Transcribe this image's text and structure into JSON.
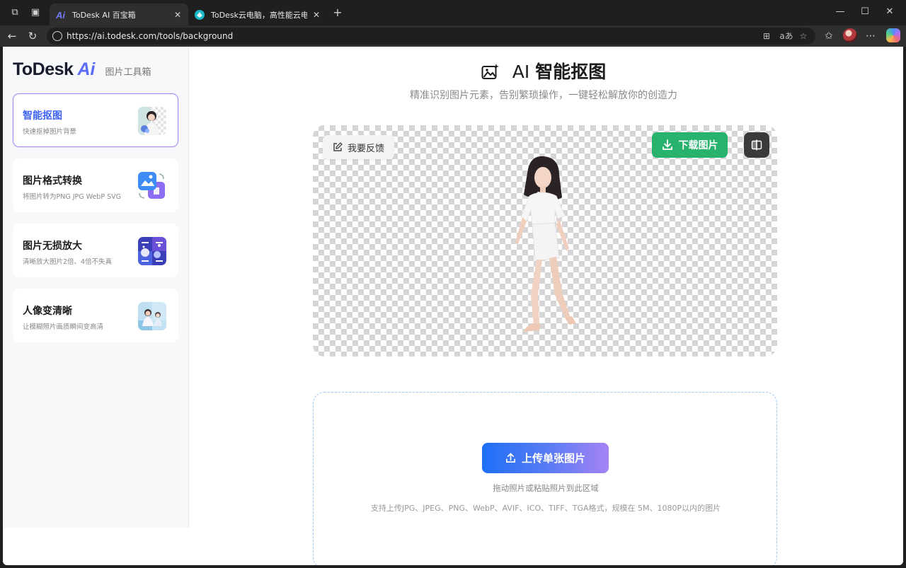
{
  "browser": {
    "tabs": [
      {
        "title": "ToDesk AI 百宝箱",
        "active": true
      },
      {
        "title": "ToDesk云电脑，高性能云电脑，云",
        "active": false
      }
    ],
    "url": "https://ai.todesk.com/tools/background",
    "reader_icon": "aあ"
  },
  "sidebar": {
    "brand_name": "ToDesk",
    "brand_ai": "Ai",
    "brand_sub": "图片工具箱",
    "tools": [
      {
        "title": "智能抠图",
        "desc": "快速抠掉图片背景",
        "active": true
      },
      {
        "title": "图片格式转换",
        "desc": "将图片转为PNG JPG WebP SVG",
        "active": false
      },
      {
        "title": "图片无损放大",
        "desc": "清晰放大图片2倍、4倍不失真",
        "active": false
      },
      {
        "title": "人像变清晰",
        "desc": "让模糊照片画质瞬间变高清",
        "active": false
      }
    ]
  },
  "main": {
    "title_prefix": "AI ",
    "title_main": "智能抠图",
    "subtitle": "精准识别图片元素，告别繁琐操作，一键轻松解放你的创造力",
    "feedback_label": "我要反馈",
    "download_label": "下载图片",
    "upload_label": "上传单张图片",
    "upload_hint": "拖动照片或粘贴照片到此区域",
    "upload_formats": "支持上传JPG、JPEG、PNG、WebP、AVIF、ICO、TIFF、TGA格式，规模在 5M、1080P以内的图片"
  },
  "colors": {
    "accent_blue": "#3c63f4",
    "download_green": "#27b36e",
    "active_border": "#a98af2"
  }
}
